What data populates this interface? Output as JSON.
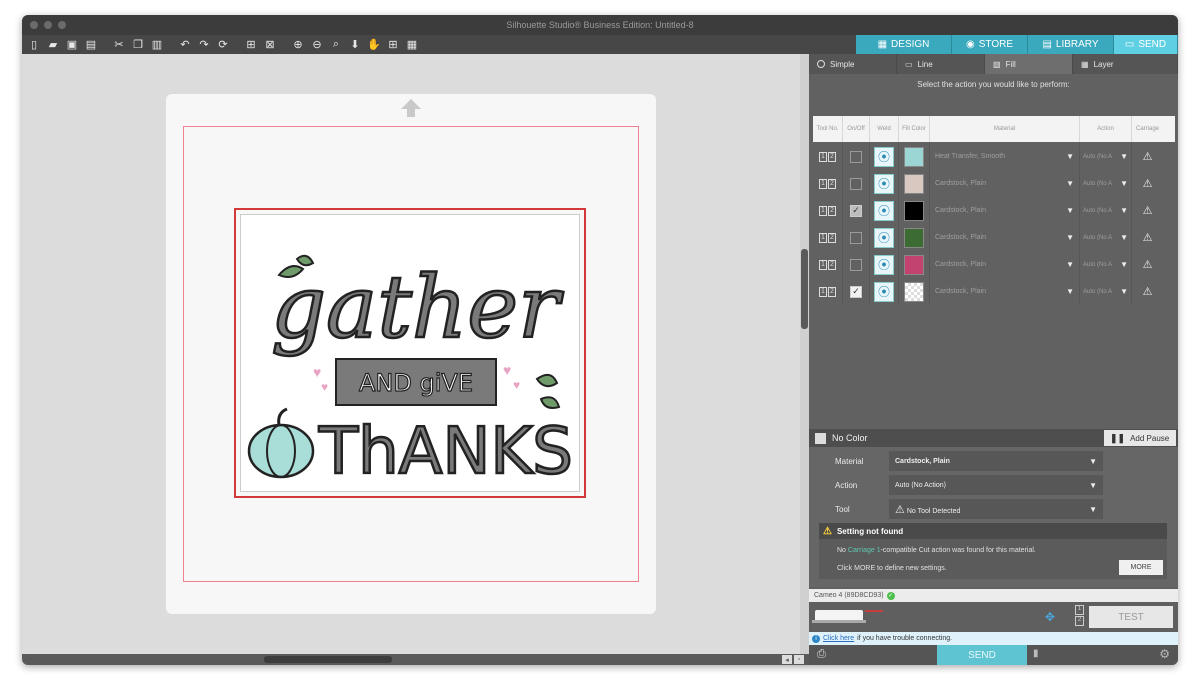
{
  "window": {
    "title": "Silhouette Studio® Business Edition: Untitled-8"
  },
  "toolbar": {
    "icons": [
      "new-file-icon",
      "open-folder-icon",
      "save-icon",
      "print-icon",
      "cut-icon",
      "copy-icon",
      "paste-icon",
      "undo-icon",
      "redo-icon",
      "rotate-icon",
      "group-icon",
      "ungroup-icon",
      "zoom-in-icon",
      "zoom-out-icon",
      "zoom-select-icon",
      "zoom-fit-icon",
      "pan-icon",
      "add-box-icon",
      "grid-icon"
    ]
  },
  "nav_tabs": [
    {
      "label": "DESIGN",
      "icon": "grid-icon"
    },
    {
      "label": "STORE",
      "icon": "store-icon"
    },
    {
      "label": "LIBRARY",
      "icon": "library-icon"
    },
    {
      "label": "SEND",
      "icon": "send-icon",
      "active": true
    }
  ],
  "panel": {
    "subtabs": [
      {
        "label": "Simple"
      },
      {
        "label": "Line"
      },
      {
        "label": "Fill",
        "active": true
      },
      {
        "label": "Layer"
      }
    ],
    "instruction": "Select the action you would like to perform:",
    "columns": [
      "Tool No.",
      "On/Off",
      "Weld",
      "Fill Color",
      "Material",
      "Action",
      "Carriage"
    ],
    "rows": [
      {
        "tool": [
          "1",
          "2"
        ],
        "checked": false,
        "dim": false,
        "color": "#9bd6d4",
        "material": "Heat Transfer, Smooth",
        "action": "Auto (No A"
      },
      {
        "tool": [
          "1",
          "2"
        ],
        "checked": false,
        "dim": false,
        "color": "#d8c8bf",
        "material": "Cardstock, Plain",
        "action": "Auto (No A"
      },
      {
        "tool": [
          "1",
          "2"
        ],
        "checked": true,
        "dim": true,
        "color": "#000000",
        "material": "Cardstock, Plain",
        "action": "Auto (No A"
      },
      {
        "tool": [
          "1",
          "2"
        ],
        "checked": false,
        "dim": false,
        "color": "#3d6b34",
        "material": "Cardstock, Plain",
        "action": "Auto (No A"
      },
      {
        "tool": [
          "1",
          "2"
        ],
        "checked": false,
        "dim": false,
        "color": "#c2436f",
        "material": "Cardstock, Plain",
        "action": "Auto (No A"
      },
      {
        "tool": [
          "1",
          "2"
        ],
        "checked": true,
        "dim": false,
        "color": "transparent",
        "material": "Cardstock, Plain",
        "action": "Auto (No A"
      }
    ],
    "no_color_label": "No Color",
    "add_pause_label": "Add Pause",
    "settings": {
      "material_label": "Material",
      "material_value": "Cardstock, Plain",
      "action_label": "Action",
      "action_value": "Auto (No Action)",
      "tool_label": "Tool",
      "tool_value": "No Tool Detected"
    },
    "warning": {
      "title": "Setting not found",
      "line1_pre": "No ",
      "line1_highlight": "Carriage 1",
      "line1_post": "-compatible Cut action was found for this material.",
      "line2": "Click MORE to define new settings.",
      "more_label": "MORE"
    },
    "device": {
      "name": "Cameo 4 (89D8CD93)"
    },
    "test_label": "TEST",
    "tool_numbers": [
      "1",
      "2"
    ],
    "info": {
      "link": "Click here",
      "text": "if you have trouble connecting."
    },
    "send_label": "SEND"
  },
  "design": {
    "word1": "gather",
    "word2": "AND giVE",
    "word3": "ThANKS"
  },
  "colors": {
    "accent": "#3aa9bd",
    "accent_active": "#5fd0e3",
    "cut_line": "#d23a3a",
    "letter_gray": "#7a7a7a",
    "pumpkin": "#a9ddd8",
    "leaf": "#6f9a6a",
    "heart": "#e7a4c3"
  }
}
